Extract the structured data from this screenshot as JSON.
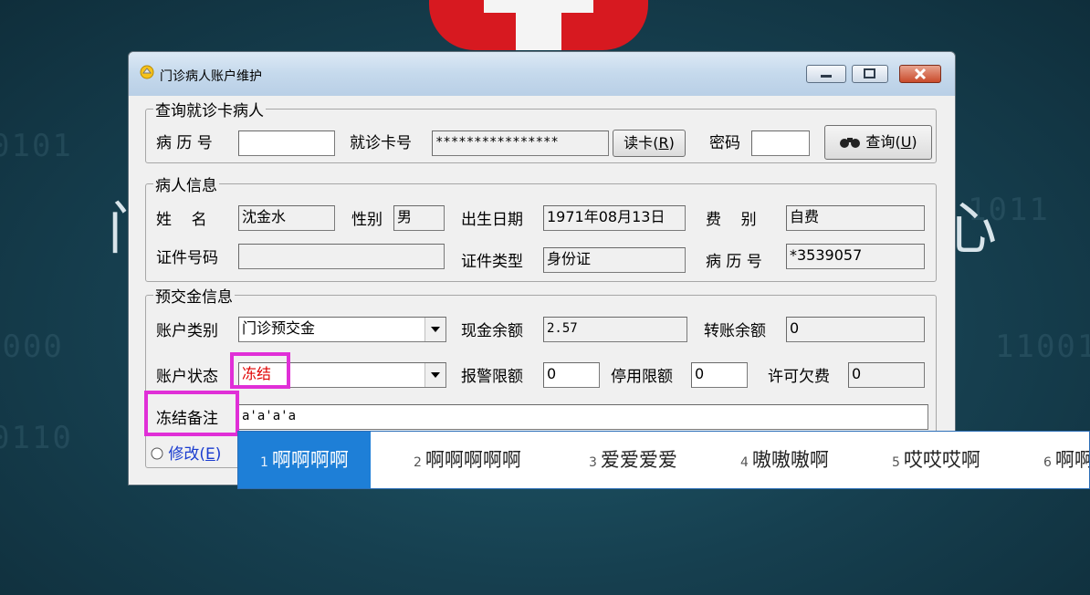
{
  "window": {
    "title": "门诊病人账户维护",
    "controls": [
      "minimize",
      "maximize",
      "close"
    ]
  },
  "query_group": {
    "legend": "查询就诊卡病人",
    "record_no_label": "病 历 号",
    "record_no_value": "",
    "card_no_label": "就诊卡号",
    "card_no_value": "****************",
    "read_card_label": "读卡",
    "read_card_key": "R",
    "password_label": "密码",
    "password_value": "",
    "query_label": "查询",
    "query_key": "U"
  },
  "patient_group": {
    "legend": "病人信息",
    "name_label": "姓    名",
    "name_value": "沈金水",
    "gender_label": "性别",
    "gender_value": "男",
    "birth_label": "出生日期",
    "birth_value": "1971年08月13日",
    "fee_label": "费    别",
    "fee_value": "自费",
    "id_no_label": "证件号码",
    "id_no_value": "",
    "id_type_label": "证件类型",
    "id_type_value": "身份证",
    "record_label": "病 历 号",
    "record_value": "*3539057"
  },
  "deposit_group": {
    "legend": "预交金信息",
    "acct_type_label": "账户类别",
    "acct_type_value": "门诊预交金",
    "cash_label": "现金余额",
    "cash_value": "2.57",
    "transfer_label": "转账余额",
    "transfer_value": "0",
    "status_label": "账户状态",
    "status_value": "冻结",
    "alarm_label": "报警限额",
    "alarm_value": "0",
    "stop_label": "停用限额",
    "stop_value": "0",
    "overdraft_label": "许可欠费",
    "overdraft_value": "0",
    "freeze_note_label": "冻结备注",
    "freeze_note_value": "a'a'a'a"
  },
  "bottom": {
    "modify_label": "修改",
    "modify_key": "E"
  },
  "ime": {
    "candidates": [
      {
        "num": "1",
        "text": "啊啊啊啊"
      },
      {
        "num": "2",
        "text": "啊啊啊啊啊"
      },
      {
        "num": "3",
        "text": "爱爱爱爱"
      },
      {
        "num": "4",
        "text": "嗷嗷嗷啊"
      },
      {
        "num": "5",
        "text": "哎哎哎啊"
      },
      {
        "num": "6",
        "text": "啊啊"
      }
    ],
    "selected": 0
  },
  "colors": {
    "highlight": "#e02fd7",
    "ime_selected": "#1e7fd7",
    "frozen_text": "#e00000",
    "modify_text": "#1a3ccf"
  }
}
